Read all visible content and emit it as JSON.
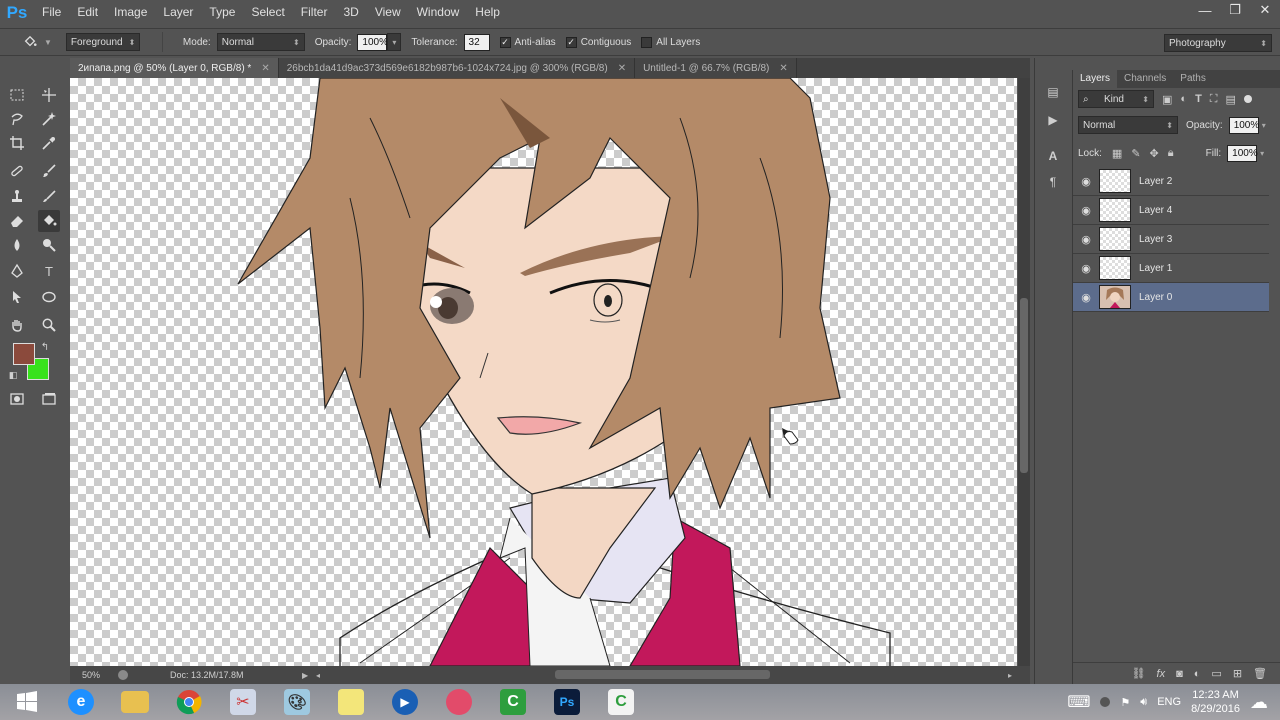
{
  "app": {
    "logo": "Ps"
  },
  "menu": [
    "File",
    "Edit",
    "Image",
    "Layer",
    "Type",
    "Select",
    "Filter",
    "3D",
    "View",
    "Window",
    "Help"
  ],
  "window_controls": {
    "minimize": "—",
    "restore": "❐",
    "close": "✕"
  },
  "options": {
    "fill_source": "Foreground",
    "mode_label": "Mode:",
    "mode_value": "Normal",
    "opacity_label": "Opacity:",
    "opacity_value": "100%",
    "tolerance_label": "Tolerance:",
    "tolerance_value": "32",
    "antialias_label": "Anti-alias",
    "contiguous_label": "Contiguous",
    "all_layers_label": "All Layers",
    "workspace": "Photography"
  },
  "tabs": [
    {
      "label": "2ипапа.png @ 50% (Layer 0, RGB/8) *",
      "close": "✕"
    },
    {
      "label": "26bcb1da41d9ac373d569e6182b987b6-1024x724.jpg @ 300% (RGB/8)",
      "close": "✕"
    },
    {
      "label": "Untitled-1 @ 66.7% (RGB/8)",
      "close": "✕"
    }
  ],
  "status": {
    "zoom": "50%",
    "doc": "Doc: 13.2M/17.8M"
  },
  "colors": {
    "foreground": "#8b4a3c",
    "background": "#38e21c",
    "accent": "#5c6c8c"
  },
  "layers_panel": {
    "tabs": [
      "Layers",
      "Channels",
      "Paths"
    ],
    "filter_label": "Kind",
    "blend_mode": "Normal",
    "opacity_label": "Opacity:",
    "opacity_value": "100%",
    "lock_label": "Lock:",
    "fill_label": "Fill:",
    "fill_value": "100%",
    "layers": [
      {
        "name": "Layer 2"
      },
      {
        "name": "Layer 4"
      },
      {
        "name": "Layer 3"
      },
      {
        "name": "Layer 1"
      },
      {
        "name": "Layer 0"
      }
    ]
  },
  "taskbar": {
    "language": "ENG",
    "time": "12:23 AM",
    "date": "8/29/2016"
  }
}
